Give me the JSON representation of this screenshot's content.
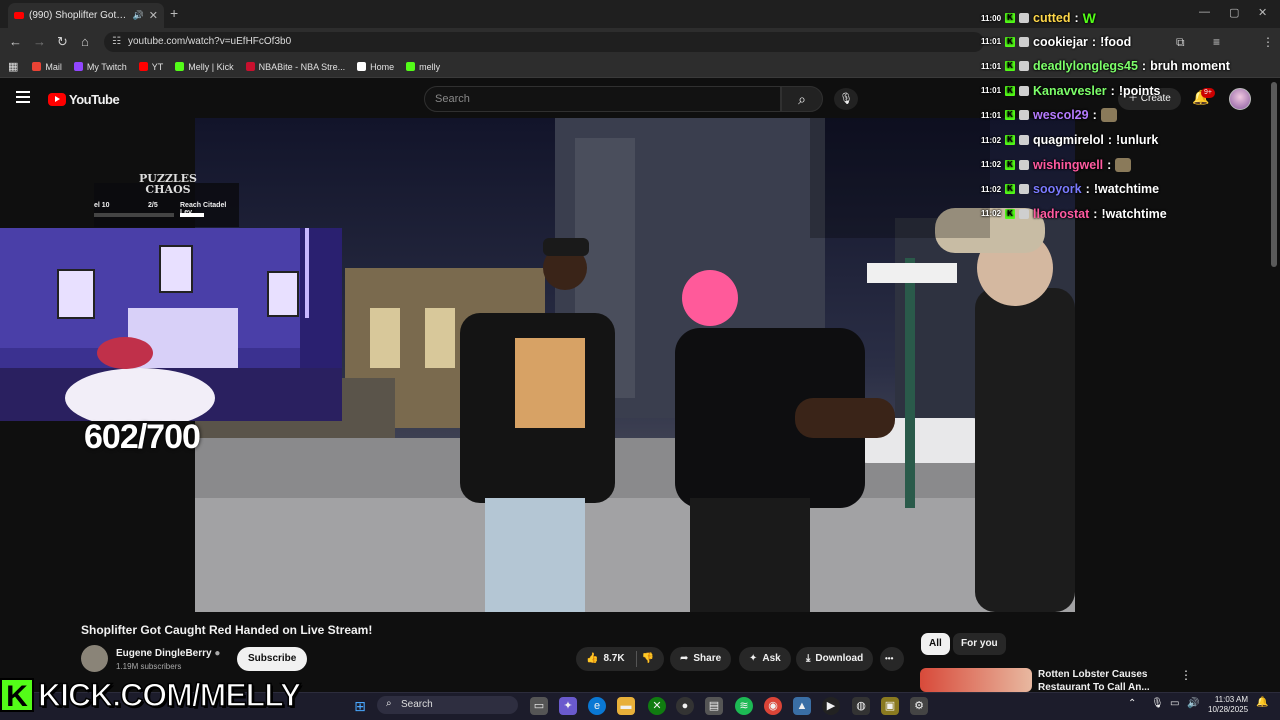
{
  "browser": {
    "tab_title": "(990) Shoplifter Got Caught",
    "new_tab": "+",
    "url": "youtube.com/watch?v=uEfHFcOf3b0",
    "bookmarks": [
      {
        "label": "Mail",
        "color": "#ea4335"
      },
      {
        "label": "My Twitch",
        "color": "#9146ff"
      },
      {
        "label": "YT",
        "color": "#ff0000"
      },
      {
        "label": "Melly | Kick",
        "color": "#53fc18"
      },
      {
        "label": "NBABite - NBA Stre...",
        "color": "#c8102e"
      },
      {
        "label": "Home",
        "color": "#ffffff"
      },
      {
        "label": "melly",
        "color": "#53fc18"
      }
    ]
  },
  "youtube": {
    "logo": "YouTube",
    "search_placeholder": "Search",
    "create_label": "Create",
    "notif_badge": "9+",
    "video_title": "Shoplifter Got Caught Red Handed on Live Stream!",
    "channel_name": "Eugene DingleBerry",
    "subscribers": "1.19M subscribers",
    "subscribe_label": "Subscribe",
    "like_count": "8.7K",
    "share_label": "Share",
    "ask_label": "Ask",
    "download_label": "Download",
    "chips": [
      "All",
      "For you"
    ],
    "rec_title": "Rotten Lobster Causes Restaurant To Call An...",
    "more": "⋮",
    "more_h": "•••"
  },
  "chat": [
    {
      "time": "11:00",
      "user": "cutted",
      "msg": "",
      "color": "#ffd84a",
      "emote": "W"
    },
    {
      "time": "11:01",
      "user": "cookiejar",
      "msg": "!food",
      "color": "#ffffff"
    },
    {
      "time": "11:01",
      "user": "deadlylonglegs45",
      "msg": "bruh moment",
      "color": "#7dff6a"
    },
    {
      "time": "11:01",
      "user": "Kanavvesler",
      "msg": "!points",
      "color": "#7dff6a"
    },
    {
      "time": "11:01",
      "user": "wescol29",
      "msg": "",
      "color": "#b57bff"
    },
    {
      "time": "11:02",
      "user": "quagmirelol",
      "msg": "!unlurk",
      "color": "#ffffff"
    },
    {
      "time": "11:02",
      "user": "wishingwell",
      "msg": "",
      "color": "#ff5aa0"
    },
    {
      "time": "11:02",
      "user": "sooyork",
      "msg": "!watchtime",
      "color": "#7a7aff"
    },
    {
      "time": "11:02",
      "user": "lladrostat",
      "msg": "!watchtime",
      "color": "#ff5aa0"
    }
  ],
  "overlay": {
    "puzzle_title": "PUZZLES CHAOS",
    "puzzle_level": "el 10",
    "puzzle_progress": "2/5",
    "puzzle_goal": "Reach Citadel Lev",
    "counter": "602/700",
    "kick_url": "KICK.COM/MELLY",
    "kick_letter": "K"
  },
  "taskbar": {
    "search_label": "Search",
    "time": "11:03 AM",
    "date": "10/28/2025"
  }
}
